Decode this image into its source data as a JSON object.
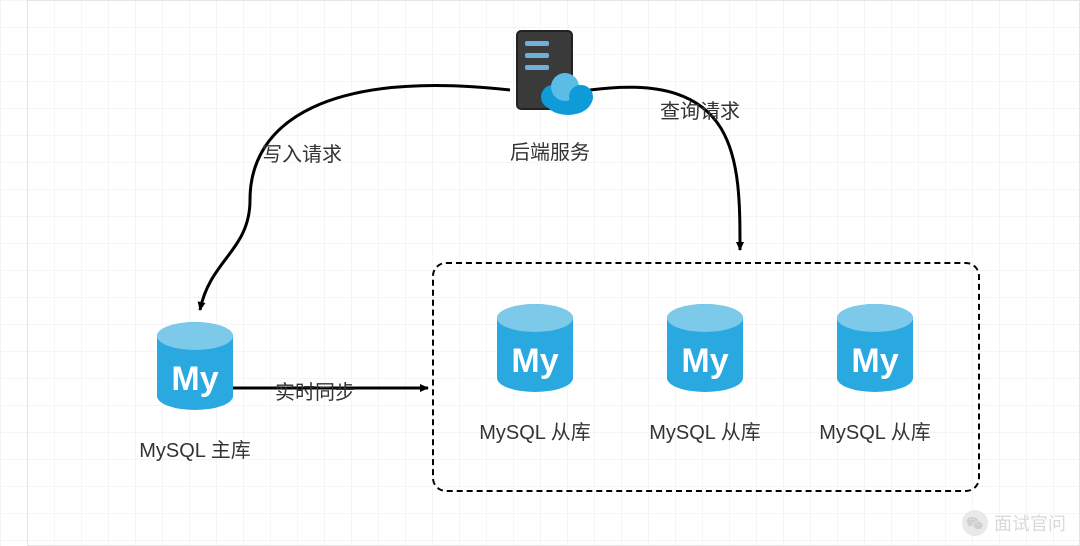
{
  "nodes": {
    "backend": {
      "label": "后端服务"
    },
    "master": {
      "label": "MySQL 主库"
    },
    "slave1": {
      "label": "MySQL 从库"
    },
    "slave2": {
      "label": "MySQL 从库"
    },
    "slave3": {
      "label": "MySQL 从库"
    }
  },
  "edges": {
    "write": {
      "label": "写入请求"
    },
    "query": {
      "label": "查询请求"
    },
    "sync": {
      "label": "实时同步"
    }
  },
  "watermark": {
    "text": "面试官问"
  }
}
